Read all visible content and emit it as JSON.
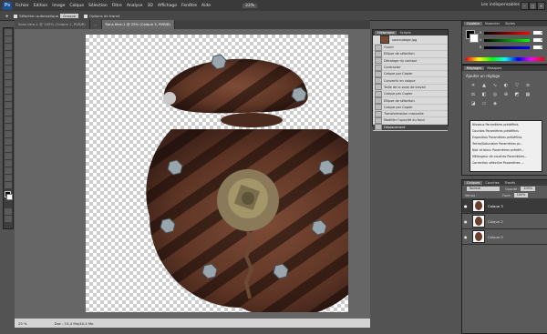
{
  "app": {
    "logo": "Ps",
    "workspace": "Les indispensables"
  },
  "menu": [
    "Fichier",
    "Edition",
    "Image",
    "Calque",
    "Sélection",
    "Filtre",
    "Analyse",
    "3D",
    "Affichage",
    "Fenêtre",
    "Aide"
  ],
  "zoom_menu": "33%",
  "window_controls": [
    "–",
    "□",
    "×"
  ],
  "options": {
    "auto_select": "Sélection automatique",
    "group": "Groupe",
    "transform": "Options de transf."
  },
  "tabs": [
    "Sans titre-1 @ 100% (Calque 1, RVB/8)",
    "…",
    "Sans titre-1 @ 25% (Calque 3, RVB/8)"
  ],
  "status": {
    "zoom": "25 %",
    "doc": "Doc : 15,4 Mo/40,4 Mo"
  },
  "history": {
    "tabs": [
      "Historique",
      "Scripts"
    ],
    "snapshot": "souroudage.jpg",
    "items": [
      "Ouvrir",
      "Ellipse de sélection",
      "Décalage du contour",
      "Contracter",
      "Calque par Copier",
      "Convertir en calque",
      "Taille de la zone de travail",
      "Calque par Copier",
      "Ellipse de sélection",
      "Calque par Copier",
      "Transformation manuelle",
      "Modifier l'opacité du fond",
      "Déplacement"
    ]
  },
  "color_panel": {
    "tabs": [
      "Couleur",
      "Nuancier",
      "Styles"
    ],
    "labels": [
      "R",
      "V",
      "B"
    ],
    "values": [
      "0",
      "0",
      "0"
    ]
  },
  "adjust_panel": {
    "tabs": [
      "Réglages",
      "Masques"
    ],
    "title": "Ajouter un réglage",
    "presets": [
      "Niveaux Paramètres prédéfinis",
      "Courbes Paramètres prédéfinis",
      "Exposition Paramètres prédéfinis",
      "Teinte/Saturation Paramètres pr...",
      "Noir et blanc Paramètres prédéfi...",
      "Mélangeur de couches Paramètres...",
      "Correction sélective Paramètres ..."
    ]
  },
  "layers_panel": {
    "tabs": [
      "Calques",
      "Couches",
      "Tracés"
    ],
    "mode": "Normal",
    "opacity_label": "Opacité :",
    "opacity": "100%",
    "lock_label": "Verrou :",
    "fill_label": "Fond :",
    "fill": "100%",
    "layers": [
      "Calque 3",
      "Calque 2",
      "Calque 0"
    ]
  },
  "colors": {
    "accent": "#1e4f8c",
    "rust": "#6a3f2c"
  }
}
